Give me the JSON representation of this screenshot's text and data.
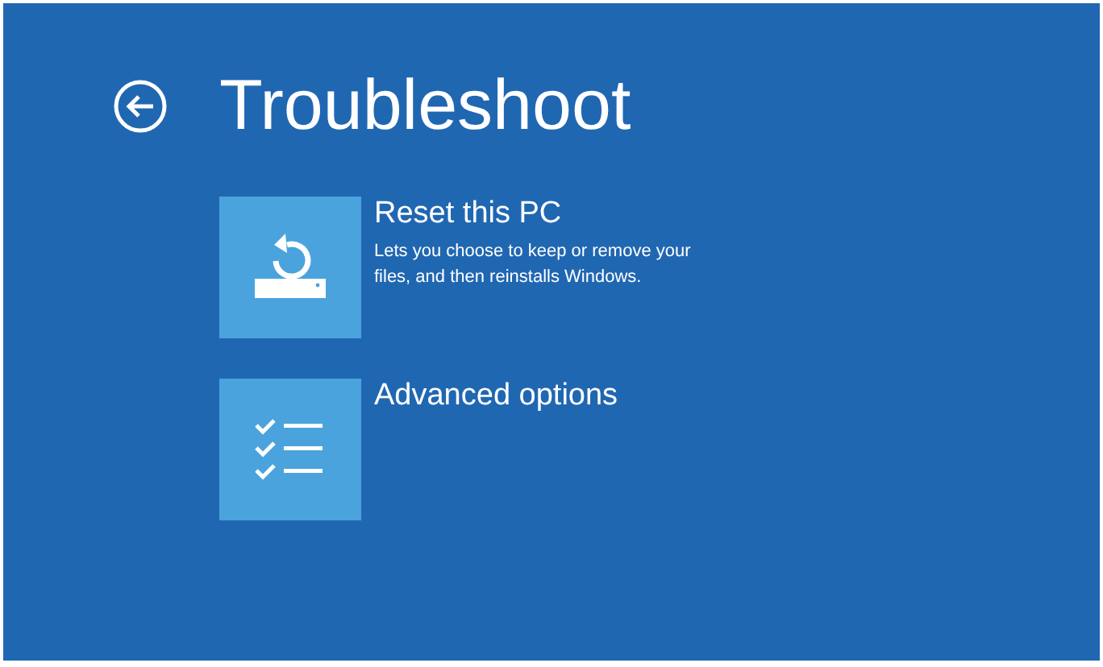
{
  "title": "Troubleshoot",
  "options": [
    {
      "kind": "reset",
      "label": "Reset this PC",
      "description": "Lets you choose to keep or remove your files, and then reinstalls Windows."
    },
    {
      "kind": "advanced",
      "label": "Advanced options"
    }
  ]
}
